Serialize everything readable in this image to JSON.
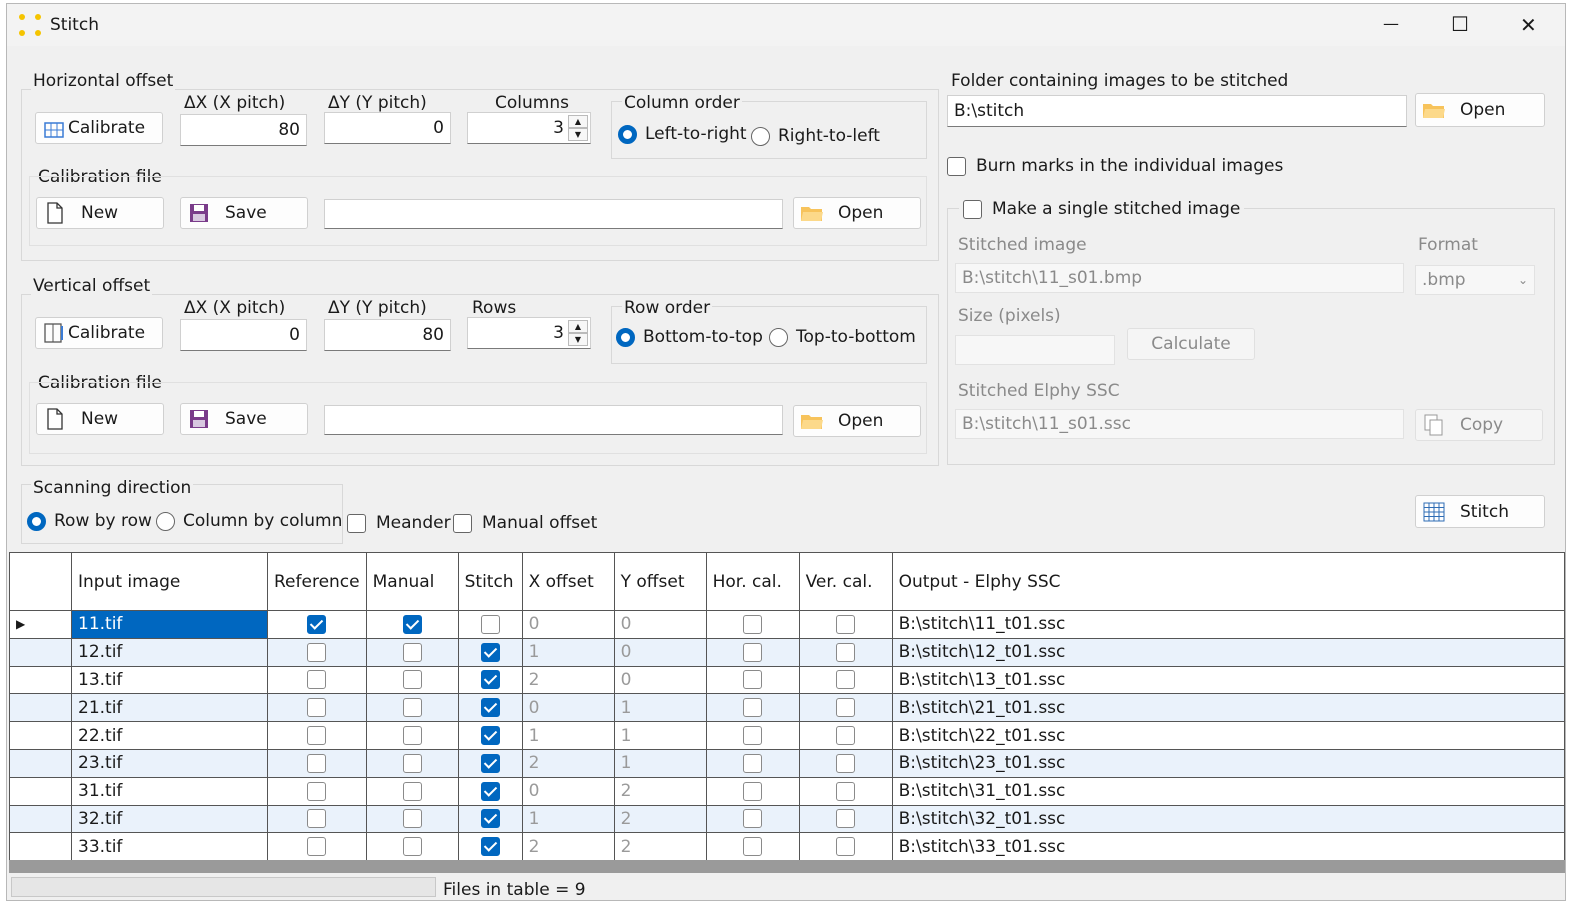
{
  "window": {
    "title": "Stitch",
    "minimize": "—",
    "maximize": "☐",
    "close": "✕"
  },
  "horizontal": {
    "group_label": "Horizontal offset",
    "calibrate": "Calibrate",
    "dx_label": "ΔX (X pitch)",
    "dx_value": "80",
    "dy_label": "ΔY (Y pitch)",
    "dy_value": "0",
    "count_label": "Columns",
    "count_value": "3",
    "order_label": "Column order",
    "order_opt1": "Left-to-right",
    "order_opt2": "Right-to-left",
    "calfile_label": "Calibration file",
    "new": "New",
    "save": "Save",
    "open": "Open",
    "file_value": ""
  },
  "vertical": {
    "group_label": "Vertical offset",
    "calibrate": "Calibrate",
    "dx_label": "ΔX (X pitch)",
    "dx_value": "0",
    "dy_label": "ΔY (Y pitch)",
    "dy_value": "80",
    "count_label": "Rows",
    "count_value": "3",
    "order_label": "Row order",
    "order_opt1": "Bottom-to-top",
    "order_opt2": "Top-to-bottom",
    "calfile_label": "Calibration file",
    "new": "New",
    "save": "Save",
    "open": "Open",
    "file_value": ""
  },
  "scanning": {
    "label": "Scanning direction",
    "opt1": "Row by row",
    "opt2": "Column by column",
    "meander": "Meander",
    "manual_offset": "Manual offset"
  },
  "folder": {
    "label": "Folder containing images to be stitched",
    "value": "B:\\stitch",
    "open": "Open"
  },
  "burn_marks": "Burn marks in the individual images",
  "single": {
    "label": "Make a single stitched image",
    "stitched_label": "Stitched image",
    "stitched_value": "B:\\stitch\\11_s01.bmp",
    "format_label": "Format",
    "format_value": ".bmp",
    "size_label": "Size (pixels)",
    "size_value": "",
    "calculate": "Calculate",
    "ssc_label": "Stitched Elphy SSC",
    "ssc_value": "B:\\stitch\\11_s01.ssc",
    "copy": "Copy"
  },
  "stitch_button": "Stitch",
  "table": {
    "headers": [
      "",
      "Input image",
      "Reference",
      "Manual",
      "Stitch",
      "X offset",
      "Y offset",
      "Hor. cal.",
      "Ver. cal.",
      "Output - Elphy SSC"
    ],
    "rows": [
      {
        "marker": "▶",
        "image": "11.tif",
        "reference": true,
        "manual": true,
        "stitch": false,
        "x": "0",
        "y": "0",
        "hor": false,
        "ver": false,
        "output": "B:\\stitch\\11_t01.ssc"
      },
      {
        "marker": "",
        "image": "12.tif",
        "reference": false,
        "manual": false,
        "stitch": true,
        "x": "1",
        "y": "0",
        "hor": false,
        "ver": false,
        "output": "B:\\stitch\\12_t01.ssc"
      },
      {
        "marker": "",
        "image": "13.tif",
        "reference": false,
        "manual": false,
        "stitch": true,
        "x": "2",
        "y": "0",
        "hor": false,
        "ver": false,
        "output": "B:\\stitch\\13_t01.ssc"
      },
      {
        "marker": "",
        "image": "21.tif",
        "reference": false,
        "manual": false,
        "stitch": true,
        "x": "0",
        "y": "1",
        "hor": false,
        "ver": false,
        "output": "B:\\stitch\\21_t01.ssc"
      },
      {
        "marker": "",
        "image": "22.tif",
        "reference": false,
        "manual": false,
        "stitch": true,
        "x": "1",
        "y": "1",
        "hor": false,
        "ver": false,
        "output": "B:\\stitch\\22_t01.ssc"
      },
      {
        "marker": "",
        "image": "23.tif",
        "reference": false,
        "manual": false,
        "stitch": true,
        "x": "2",
        "y": "1",
        "hor": false,
        "ver": false,
        "output": "B:\\stitch\\23_t01.ssc"
      },
      {
        "marker": "",
        "image": "31.tif",
        "reference": false,
        "manual": false,
        "stitch": true,
        "x": "0",
        "y": "2",
        "hor": false,
        "ver": false,
        "output": "B:\\stitch\\31_t01.ssc"
      },
      {
        "marker": "",
        "image": "32.tif",
        "reference": false,
        "manual": false,
        "stitch": true,
        "x": "1",
        "y": "2",
        "hor": false,
        "ver": false,
        "output": "B:\\stitch\\32_t01.ssc"
      },
      {
        "marker": "",
        "image": "33.tif",
        "reference": false,
        "manual": false,
        "stitch": true,
        "x": "2",
        "y": "2",
        "hor": false,
        "ver": false,
        "output": "B:\\stitch\\33_t01.ssc"
      }
    ]
  },
  "status": {
    "text": "Files in table = 9",
    "progress": 0
  },
  "icons": [
    "app-icon",
    "calibrate-icon",
    "new-file-icon",
    "save-icon",
    "folder-icon",
    "copy-icon",
    "stitch-grid-icon",
    "row-arrow-icon"
  ],
  "colors": {
    "accent": "#0067c0",
    "alt_row": "#eaf2fb",
    "window_bg": "#f0f0f0"
  }
}
